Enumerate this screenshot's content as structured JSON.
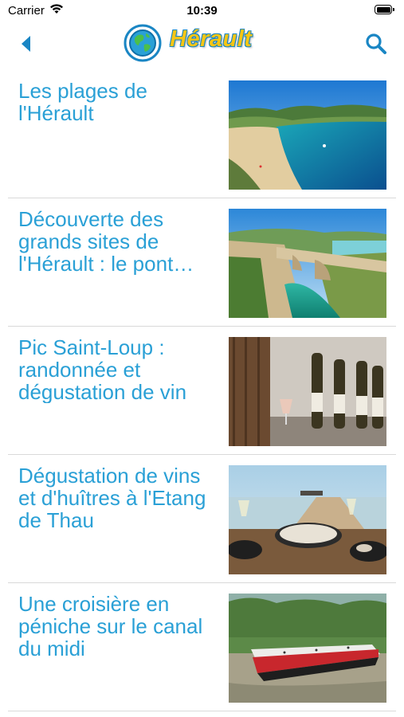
{
  "status_bar": {
    "carrier": "Carrier",
    "time": "10:39"
  },
  "nav": {
    "brand": "Hérault",
    "back_icon": "chevron-left-icon",
    "search_icon": "search-icon",
    "accent_color": "#1a86c4",
    "brand_color": "#f6c514"
  },
  "articles": [
    {
      "title": "Les plages de l'Hérault",
      "image": "beach-coast-photo"
    },
    {
      "title": "Découverte des grands sites de l'Hérault : le pont…",
      "image": "stone-bridge-gorge-photo"
    },
    {
      "title": "Pic Saint-Loup  : randonnée et dégustation de vin",
      "image": "wine-bottles-photo"
    },
    {
      "title": "Dégustation de vins et d'huîtres à l'Etang de Thau",
      "image": "oysters-wine-lagoon-photo"
    },
    {
      "title": "Une croisière en péniche sur le canal du midi",
      "image": "canal-barge-photo"
    }
  ],
  "title_color": "#2aa0d6"
}
